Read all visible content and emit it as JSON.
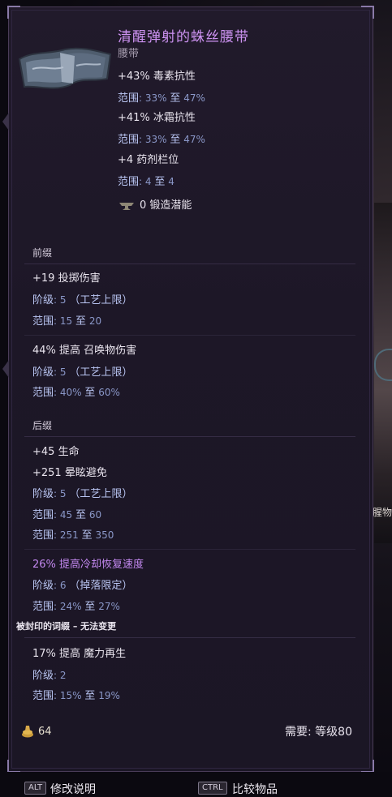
{
  "item": {
    "name": "清醒弹射的蛛丝腰带",
    "type": "腰带",
    "implicits": [
      {
        "text": "+43% 毒素抗性",
        "range_label": "范围",
        "range_lo": "33%",
        "to": "至",
        "range_hi": "47%"
      },
      {
        "text": "+41% 冰霜抗性",
        "range_label": "范围",
        "range_lo": "33%",
        "to": "至",
        "range_hi": "47%"
      },
      {
        "text": "+4 药剂栏位",
        "range_label": "范围",
        "range_lo": "4",
        "to": "至",
        "range_hi": "4"
      }
    ],
    "forge_potential": "0 锻造潜能"
  },
  "prefix": {
    "header": "前缀",
    "affixes": [
      {
        "text": "+19 投掷伤害",
        "tier_label": "阶级",
        "tier": "5",
        "tier_note": "（工艺上限）",
        "range_label": "范围",
        "range_lo": "15",
        "to": "至",
        "range_hi": "20"
      },
      {
        "text": "44% 提高 召唤物伤害",
        "tier_label": "阶级",
        "tier": "5",
        "tier_note": "（工艺上限）",
        "range_label": "范围",
        "range_lo": "40%",
        "to": "至",
        "range_hi": "60%"
      }
    ]
  },
  "suffix": {
    "header": "后缀",
    "affix1": {
      "text1": "+45 生命",
      "text2": "+251 晕眩避免",
      "tier_label": "阶级",
      "tier": "5",
      "tier_note": "（工艺上限）",
      "range1_label": "范围",
      "range1_lo": "45",
      "range1_to": "至",
      "range1_hi": "60",
      "range2_label": "范围",
      "range2_lo": "251",
      "range2_to": "至",
      "range2_hi": "350"
    },
    "affix2": {
      "text": "26% 提高冷却恢复速度",
      "tier_label": "阶级",
      "tier": "6",
      "tier_note": "（掉落限定）",
      "range_label": "范围",
      "range_lo": "24%",
      "to": "至",
      "range_hi": "27%"
    },
    "sealed_note": "被封印的词缀 – 无法变更",
    "sealed": {
      "text": "17% 提高 魔力再生",
      "tier_label": "阶级",
      "tier": "2",
      "range_label": "范围",
      "range_lo": "15%",
      "to": "至",
      "range_hi": "19%"
    }
  },
  "footer": {
    "gold": "64",
    "req_label": "需要:",
    "req_level": "等级",
    "req_value": "80"
  },
  "hotkeys": [
    {
      "key": "ALT",
      "label": "修改说明"
    },
    {
      "key": "CTRL",
      "label": "比较物品"
    }
  ],
  "side_text": "腥物",
  "colors": {
    "title": "#cd93f2",
    "affix": "#a9b9ee",
    "sealed": "#c388f0"
  }
}
